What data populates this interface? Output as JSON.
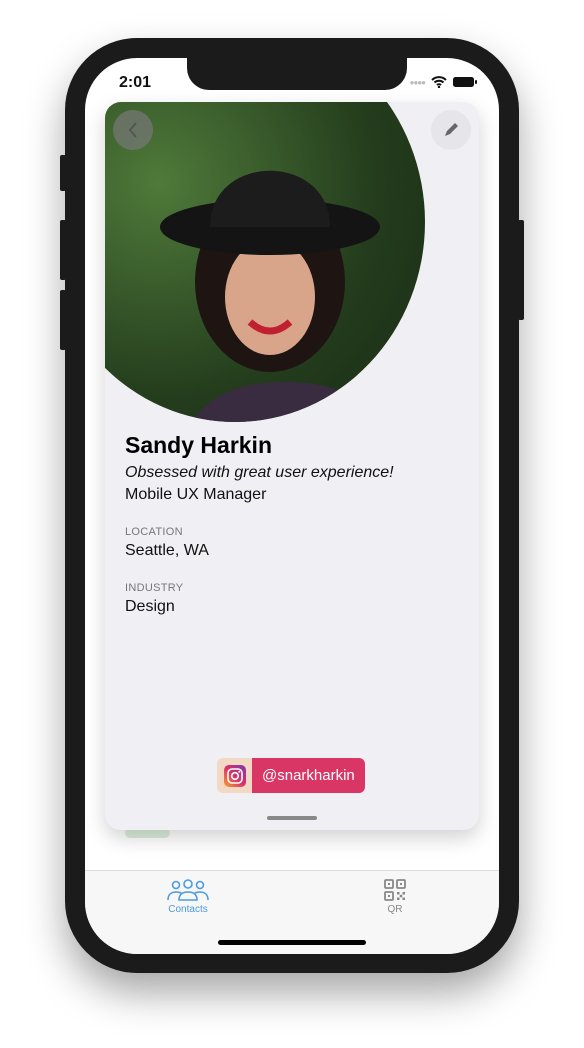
{
  "status_bar": {
    "time": "2:01"
  },
  "profile": {
    "name": "Sandy Harkin",
    "tagline": "Obsessed with great user experience!",
    "job_title": "Mobile UX Manager",
    "location_label": "LOCATION",
    "location": "Seattle, WA",
    "industry_label": "INDUSTRY",
    "industry": "Design",
    "instagram_handle": "@snarkharkin"
  },
  "tabs": [
    {
      "label": "Contacts",
      "icon": "contacts-icon",
      "active": true,
      "color": "#4a9be0"
    },
    {
      "label": "QR",
      "icon": "qr-code-icon",
      "active": false,
      "color": "#888888"
    }
  ],
  "colors": {
    "instagram": "#d93665",
    "card_bg": "#f0eff4"
  }
}
